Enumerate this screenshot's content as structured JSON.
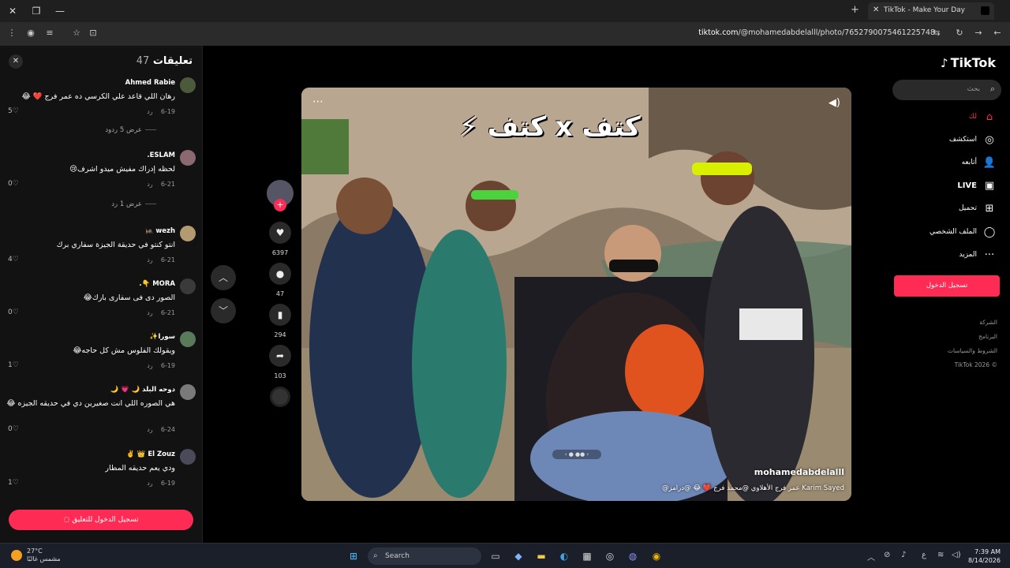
{
  "browser": {
    "tab_title": "TikTok - Make Your Day",
    "url_host": "tiktok.com",
    "url_path": "/@mohamedabdelalll/photo/7652790075461225748"
  },
  "comments_panel": {
    "title": "تعليقات",
    "count": "47",
    "reply_label": "رد",
    "login_to_comment": "تسجيل الدخول للتعليق",
    "items": [
      {
        "user": "Ahmed Rabie",
        "text": "رهان اللي قاعد علي الكرسي ده عمر فرج ❤️ 😂",
        "date": "6-19",
        "likes": "5",
        "replies": "عرض 5 ردود"
      },
      {
        "user": "ESLAM.",
        "text": "لحظه إدراك مفيش ميدو اشرف😢",
        "date": "6-21",
        "likes": "0",
        "replies": "عرض 1 رد"
      },
      {
        "user": "wezh 🦗",
        "text": "انتو كنتو في حديقة الجيزة سفاري برك",
        "date": "6-21",
        "likes": "4"
      },
      {
        "user": "MORA 👇.",
        "text": "الصور دى فى سفارى بارك😂",
        "date": "6-21",
        "likes": "0"
      },
      {
        "user": "سورا✨",
        "text": "ويقولك الفلوس مش كل حاجه😂",
        "date": "6-19",
        "likes": "1"
      },
      {
        "user": "دوحه البلد 🌙 💗 🌙",
        "text": "هي الصوره اللي انت صغيرين دي في حديقه الجيزه 😂",
        "date": "6-24",
        "likes": "0"
      },
      {
        "user": "El Zouz 👑 ✌️",
        "text": "ودي يعم حديقه المطار",
        "date": "6-19",
        "likes": "1"
      }
    ]
  },
  "actions": {
    "likes": "6397",
    "comments": "47",
    "saves": "294",
    "shares": "103"
  },
  "post": {
    "title_text": "كتف x كتف ⚡",
    "username": "mohamedabdelalll",
    "caption": "@عمر فرج الأهلاوي @محمد فرج ❤️ 😂 @درامز  Karim Sayed"
  },
  "sidebar": {
    "logo": "TikTok",
    "search_placeholder": "بحث",
    "nav": [
      {
        "label": "لك",
        "icon": "⌂"
      },
      {
        "label": "استكشف",
        "icon": "◎"
      },
      {
        "label": "أتابعه",
        "icon": "👤"
      },
      {
        "label": "LIVE",
        "icon": "▣"
      },
      {
        "label": "تحميل",
        "icon": "⊞"
      },
      {
        "label": "الملف الشخصي",
        "icon": "◯"
      },
      {
        "label": "المزيد",
        "icon": "···"
      }
    ],
    "login": "تسجيل الدخول",
    "footer": [
      "الشركة",
      "البرنامج",
      "الشروط والسياسات",
      "© 2026 TikTok"
    ]
  },
  "taskbar": {
    "temp": "27°C",
    "weather": "مشمس غالبًا",
    "search": "Search",
    "time": "7:39 AM",
    "date": "8/14/2026"
  }
}
